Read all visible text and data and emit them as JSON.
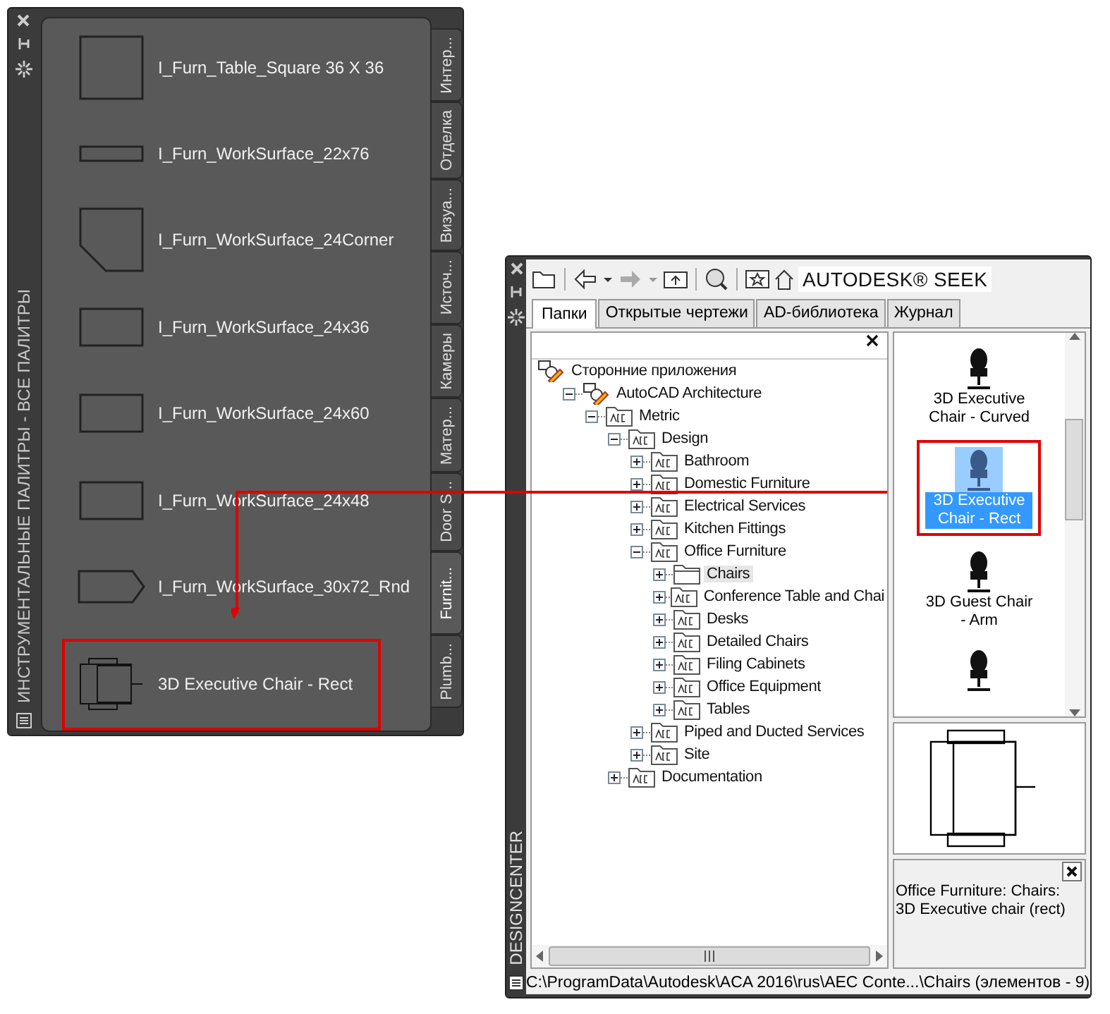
{
  "tool_palette": {
    "title": "ИНСТРУМЕНТАЛЬНЫЕ ПАЛИТРЫ - ВСЕ ПАЛИТРЫ",
    "items": [
      {
        "kind": "square",
        "label": "I_Furn_Table_Square 36 X 36",
        "callout": false
      },
      {
        "kind": "thin",
        "label": "I_Furn_WorkSurface_22x76",
        "callout": false
      },
      {
        "kind": "corner",
        "label": "I_Furn_WorkSurface_24Corner",
        "callout": false
      },
      {
        "kind": "rect",
        "label": "I_Furn_WorkSurface_24x36",
        "callout": false
      },
      {
        "kind": "rect",
        "label": "I_Furn_WorkSurface_24x60",
        "callout": false
      },
      {
        "kind": "rect",
        "label": "I_Furn_WorkSurface_24x48",
        "callout": false
      },
      {
        "kind": "pointed",
        "label": "I_Furn_WorkSurface_30x72_Rnd",
        "callout": false
      },
      {
        "kind": "chair",
        "label": "3D Executive Chair - Rect",
        "callout": true
      }
    ],
    "tabs": [
      {
        "label": "Интер...",
        "selected": false
      },
      {
        "label": "Отделка",
        "selected": false
      },
      {
        "label": "Визуа...",
        "selected": false
      },
      {
        "label": "Источ...",
        "selected": false
      },
      {
        "label": "Камеры",
        "selected": false
      },
      {
        "label": "Матер...",
        "selected": false
      },
      {
        "label": "Door S...",
        "selected": false
      },
      {
        "label": "Furnit...",
        "selected": true
      },
      {
        "label": "Plumb...",
        "selected": false
      }
    ]
  },
  "designcenter": {
    "title": "DESIGNCENTER",
    "seek": "AUTODESK® SEEK",
    "tabs": [
      {
        "label": "Папки",
        "selected": true
      },
      {
        "label": "Открытые чертежи",
        "selected": false
      },
      {
        "label": "AD-библиотека",
        "selected": false
      },
      {
        "label": "Журнал",
        "selected": false
      }
    ],
    "tree": [
      {
        "label": "Сторонние приложения",
        "kind": "app",
        "selected": false,
        "children": [
          {
            "label": "AutoCAD Architecture",
            "kind": "app",
            "expanded": true,
            "selected": false,
            "children": [
              {
                "label": "Metric",
                "kind": "aec",
                "expanded": true,
                "selected": false,
                "children": [
                  {
                    "label": "Design",
                    "kind": "aec",
                    "expanded": true,
                    "selected": false,
                    "children": [
                      {
                        "label": "Bathroom",
                        "kind": "aec",
                        "expanded": false,
                        "selected": false
                      },
                      {
                        "label": "Domestic Furniture",
                        "kind": "aec",
                        "expanded": false,
                        "selected": false
                      },
                      {
                        "label": "Electrical Services",
                        "kind": "aec",
                        "expanded": false,
                        "selected": false
                      },
                      {
                        "label": "Kitchen Fittings",
                        "kind": "aec",
                        "expanded": false,
                        "selected": false
                      },
                      {
                        "label": "Office Furniture",
                        "kind": "aec",
                        "expanded": true,
                        "selected": false,
                        "children": [
                          {
                            "label": "Chairs",
                            "kind": "folder",
                            "expanded": false,
                            "selected": true
                          },
                          {
                            "label": "Conference Table and Chai",
                            "kind": "aec",
                            "expanded": false,
                            "selected": false
                          },
                          {
                            "label": "Desks",
                            "kind": "aec",
                            "expanded": false,
                            "selected": false
                          },
                          {
                            "label": "Detailed Chairs",
                            "kind": "aec",
                            "expanded": false,
                            "selected": false
                          },
                          {
                            "label": "Filing Cabinets",
                            "kind": "aec",
                            "expanded": false,
                            "selected": false
                          },
                          {
                            "label": "Office Equipment",
                            "kind": "aec",
                            "expanded": false,
                            "selected": false
                          },
                          {
                            "label": "Tables",
                            "kind": "aec",
                            "expanded": false,
                            "selected": false
                          }
                        ]
                      },
                      {
                        "label": "Piped and Ducted Services",
                        "kind": "aec",
                        "expanded": false,
                        "selected": false
                      },
                      {
                        "label": "Site",
                        "kind": "aec",
                        "expanded": false,
                        "selected": false
                      }
                    ]
                  },
                  {
                    "label": "Documentation",
                    "kind": "aec",
                    "expanded": false,
                    "selected": false
                  }
                ]
              }
            ]
          }
        ]
      }
    ],
    "content": [
      {
        "label": "3D Executive Chair - Curved",
        "selected": false,
        "callout": false
      },
      {
        "label": "3D Executive Chair - Rect",
        "selected": true,
        "callout": true
      },
      {
        "label": "3D Guest Chair - Arm",
        "selected": false,
        "callout": false
      },
      {
        "selected": false,
        "callout": false
      }
    ],
    "description": "Office Furniture: Chairs: 3D Executive chair (rect)",
    "status_bar": "C:\\ProgramData\\Autodesk\\ACA 2016\\rus\\AEC Conte...\\Chairs (элементов  - 9)"
  }
}
